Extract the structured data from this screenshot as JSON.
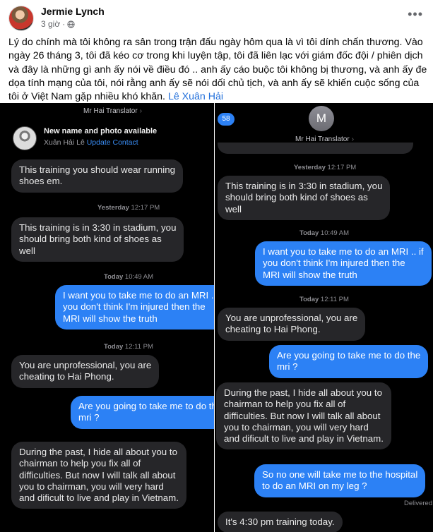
{
  "post": {
    "author": "Jermie Lynch",
    "time": "3 giờ",
    "text": "Lý do chính mà tôi không ra sân trong trận đấu ngày hôm qua là vì tôi dính chấn thương. Vào ngày 26 tháng 3, tôi đã kéo cơ trong khi luyện tập, tôi đã liên lạc với giám đốc đội / phiên dịch và đây là những gì anh ấy nói về điều đó .. anh ấy cáo buộc tôi không bị thương, và anh ấy đe dọa tính mạng của tôi, nói rằng anh ấy sẽ nói dối chủ tịch, và anh ấy sẽ khiến cuộc sống của tôi ở Việt Nam gặp nhiều khó khăn.",
    "tag": "Lê Xuân Hải",
    "more_icon": "more-horizontal-icon",
    "privacy_icon": "globe-icon"
  },
  "left": {
    "contact": "Mr Hai Translator",
    "banner_title": "New name and photo available",
    "banner_name": "Xuân Hải Lê",
    "banner_link": "Update Contact",
    "msg1": "This training you should wear running shoes em.",
    "msg1_lines": [
      "This training you should wear running",
      "shoes em."
    ],
    "stamp1_day": "Yesterday",
    "stamp1_time": "12:17 PM",
    "msg2_lines": [
      "This training is in 3:30 in stadium, you",
      "should bring both kind of shoes as",
      "well"
    ],
    "stamp2_day": "Today",
    "stamp2_time": "10:49 AM",
    "msg3_lines": [
      "I want you to take me to do an MRI .. if",
      "you don't think I'm injured then the",
      "MRI will show the truth"
    ],
    "stamp3_day": "Today",
    "stamp3_time": "12:11 PM",
    "msg4_lines": [
      "You are unprofessional, you are",
      "cheating to Hai Phong."
    ],
    "msg5_lines": [
      "Are you going to take me to do the",
      "mri ?"
    ],
    "msg6_lines": [
      "During the past, I hide all about you to",
      "chairman to help you fix all of",
      "difficulties. But now I will talk all about",
      "you to chairman, you will very hard",
      "and dificult to live and play in Vietnam."
    ]
  },
  "right": {
    "avatar_letter": "M",
    "back_count": "58",
    "contact": "Mr Hai Translator",
    "stamp1_day": "Yesterday",
    "stamp1_time": "12:17 PM",
    "msg1_lines": [
      "This training is in 3:30 in stadium, you",
      "should bring both kind of shoes as",
      "well"
    ],
    "stamp2_day": "Today",
    "stamp2_time": "10:49 AM",
    "msg2_lines": [
      "I want you to take me to do an MRI .. if",
      "you don't think I'm injured then the",
      "MRI will show the truth"
    ],
    "stamp3_day": "Today",
    "stamp3_time": "12:11 PM",
    "msg3_lines": [
      "You are unprofessional, you are",
      "cheating to Hai Phong."
    ],
    "msg4_lines": [
      "Are you going to take me to do the",
      "mri ?"
    ],
    "msg5_lines": [
      "During the past, I hide all about you to",
      "chairman to help you fix all of",
      "difficulties. But now I will talk all about",
      "you to chairman, you will very hard",
      "and dificult to live and play in Vietnam."
    ],
    "msg6_lines": [
      "So no one will take me to the hospital",
      "to do an MRI on my leg ?"
    ],
    "delivered": "Delivered",
    "msg7": "It's 4:30 pm training today."
  },
  "colors": {
    "imessage_blue": "#2c81f5",
    "incoming_gray": "#262629",
    "link_blue": "#216fdb"
  }
}
